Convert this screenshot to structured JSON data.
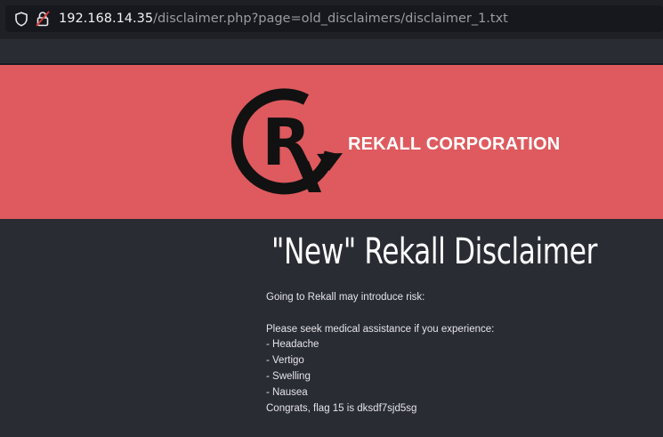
{
  "browser": {
    "url_host": "192.168.14.35",
    "url_path": "/disclaimer.php?page=old_disclaimers/disclaimer_1.txt"
  },
  "header": {
    "company_name": "REKALL CORPORATION",
    "background_color": "#de5a5e"
  },
  "main": {
    "title": "\"New\" Rekall Disclaimer",
    "lines": [
      "Going to Rekall may introduce risk:",
      "",
      "Please seek medical assistance if you experience:",
      "- Headache",
      "- Vertigo",
      "- Swelling",
      "- Nausea",
      "Congrats, flag 15 is dksdf7sjd5sg"
    ]
  },
  "icons": {
    "shield": "shield-icon",
    "lock": "lock-warning-icon",
    "logo": "rekall-logo"
  }
}
